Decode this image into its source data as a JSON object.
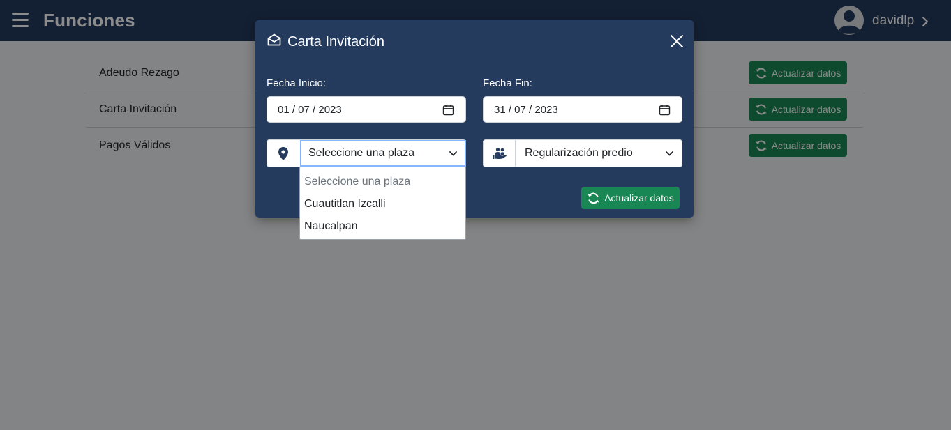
{
  "topbar": {
    "title": "Funciones",
    "username": "davidlp"
  },
  "functions": [
    {
      "label": "Adeudo Rezago",
      "button": "Actualizar datos"
    },
    {
      "label": "Carta Invitación",
      "button": "Actualizar datos"
    },
    {
      "label": "Pagos Válidos",
      "button": "Actualizar datos"
    }
  ],
  "modal": {
    "title": "Carta Invitación",
    "start_label": "Fecha Inicio:",
    "start_value": "01 / 07 / 2023",
    "end_label": "Fecha Fin:",
    "end_value": "31 / 07 / 2023",
    "plaza_selected": "Seleccione una plaza",
    "type_selected": "Regularización predio",
    "update_button": "Actualizar datos"
  },
  "plaza_options": [
    "Seleccione una plaza",
    "Cuautitlan Izcalli",
    "Naucalpan"
  ],
  "colors": {
    "navbar": "#243b5e",
    "success": "#198754",
    "backdrop": "rgba(0,0,0,0.45)"
  },
  "icons": {
    "menu": "menu-icon",
    "avatar": "user-avatar-icon",
    "chevron": "chevron-right-icon",
    "envelope": "envelope-open-icon",
    "close": "close-icon",
    "calendar": "calendar-icon",
    "location": "map-pin-icon",
    "type": "person-hand-icon",
    "refresh": "refresh-icon"
  }
}
